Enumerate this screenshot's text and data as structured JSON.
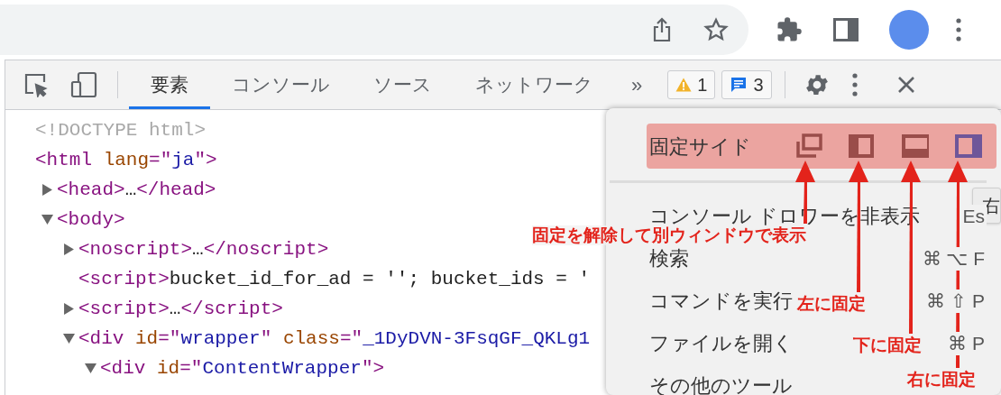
{
  "devtools": {
    "tabs": [
      {
        "label": "要素",
        "selected": true
      },
      {
        "label": "コンソール",
        "selected": false
      },
      {
        "label": "ソース",
        "selected": false
      },
      {
        "label": "ネットワーク",
        "selected": false
      }
    ],
    "more_tabs": "»",
    "warnings": "1",
    "messages": "3"
  },
  "dom_tree": [
    {
      "segments": [
        {
          "kind": "doctype",
          "text": "<!DOCTYPE html>"
        }
      ]
    },
    {
      "segments": [
        {
          "kind": "tag",
          "text": "<html "
        },
        {
          "kind": "attr",
          "text": "lang"
        },
        {
          "kind": "tag",
          "text": "=\""
        },
        {
          "kind": "value",
          "text": "ja"
        },
        {
          "kind": "tag",
          "text": "\">"
        }
      ],
      "children": [
        {
          "expanded": false,
          "segments": [
            {
              "kind": "tag",
              "text": "<head>"
            },
            {
              "kind": "text",
              "text": "…"
            },
            {
              "kind": "tag",
              "text": "</head>"
            }
          ]
        },
        {
          "expanded": true,
          "segments": [
            {
              "kind": "tag",
              "text": "<body>"
            }
          ],
          "children": [
            {
              "expanded": false,
              "segments": [
                {
                  "kind": "tag",
                  "text": "<noscript>"
                },
                {
                  "kind": "text",
                  "text": "…"
                },
                {
                  "kind": "tag",
                  "text": "</noscript>"
                }
              ]
            },
            {
              "segments": [
                {
                  "kind": "tag",
                  "text": "<script>"
                },
                {
                  "kind": "text",
                  "text": "bucket_id_for_ad = ''; bucket_ids = '"
                }
              ]
            },
            {
              "expanded": false,
              "segments": [
                {
                  "kind": "tag",
                  "text": "<script>"
                },
                {
                  "kind": "text",
                  "text": "…"
                },
                {
                  "kind": "tag",
                  "text": "</script>"
                }
              ]
            },
            {
              "expanded": true,
              "segments": [
                {
                  "kind": "tag",
                  "text": "<div "
                },
                {
                  "kind": "attr",
                  "text": "id"
                },
                {
                  "kind": "tag",
                  "text": "=\""
                },
                {
                  "kind": "value",
                  "text": "wrapper"
                },
                {
                  "kind": "tag",
                  "text": "\" "
                },
                {
                  "kind": "attr",
                  "text": "class"
                },
                {
                  "kind": "tag",
                  "text": "=\""
                },
                {
                  "kind": "value",
                  "text": "_1DyDVN-3FsqGF_QKLg1"
                }
              ],
              "children": [
                {
                  "expanded": true,
                  "segments": [
                    {
                      "kind": "tag",
                      "text": "<div "
                    },
                    {
                      "kind": "attr",
                      "text": "id"
                    },
                    {
                      "kind": "tag",
                      "text": "=\""
                    },
                    {
                      "kind": "value",
                      "text": "ContentWrapper"
                    },
                    {
                      "kind": "tag",
                      "text": "\">"
                    }
                  ]
                }
              ]
            }
          ]
        }
      ]
    }
  ],
  "menu": {
    "dock_side": {
      "label": "固定サイド",
      "options": [
        {
          "kind": "undock",
          "selected": false
        },
        {
          "kind": "left",
          "selected": false
        },
        {
          "kind": "bottom",
          "selected": false
        },
        {
          "kind": "right",
          "selected": true
        }
      ]
    },
    "items": [
      {
        "label": "コンソール ドロワーを非表示",
        "shortcut": "Es"
      },
      {
        "label": "検索",
        "shortcut": "⌘ ⌥ F"
      },
      {
        "label": "コマンドを実行",
        "shortcut": "⌘ ⇧ P"
      },
      {
        "label": "ファイルを開く",
        "shortcut": "⌘ P"
      },
      {
        "label": "その他のツール"
      }
    ]
  },
  "tooltip": "右",
  "annotations": [
    {
      "text": "固定を解除して別ウィンドウで表示"
    },
    {
      "text": "左に固定"
    },
    {
      "text": "下に固定"
    },
    {
      "text": "右に固定"
    }
  ]
}
